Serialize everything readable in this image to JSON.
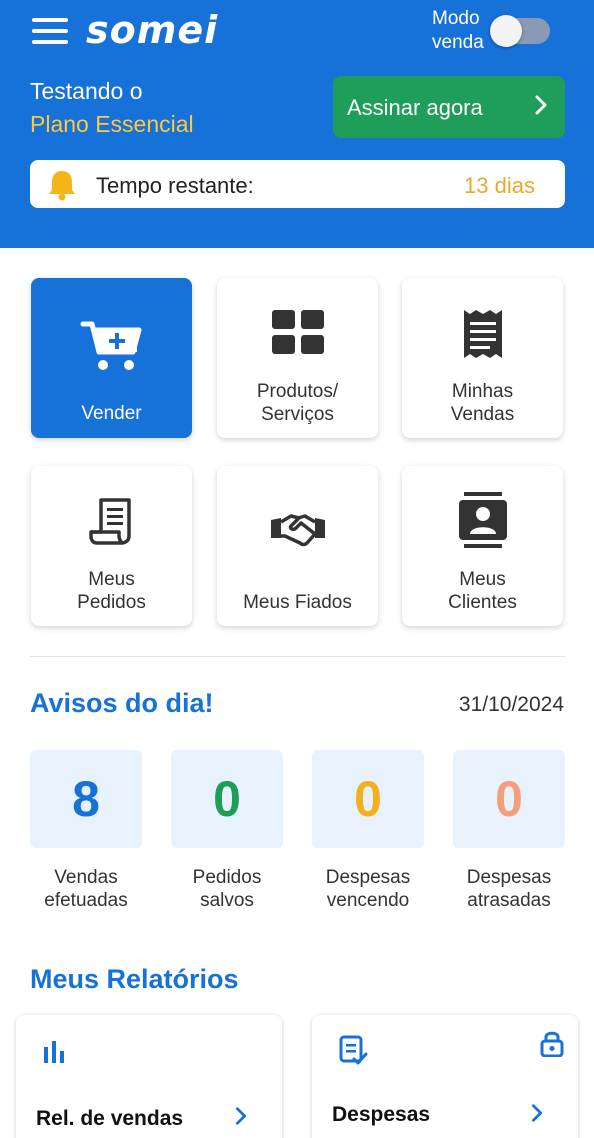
{
  "header": {
    "logo_text": "somei",
    "mode_label_line1": "Modo",
    "mode_label_line2": "venda",
    "mode_toggle_on": false,
    "trial_line1": "Testando o",
    "trial_line2": "Plano Essencial",
    "subscribe_label": "Assinar agora",
    "time_label": "Tempo restante:",
    "time_value": "13 dias",
    "brand_color": "#1671d8"
  },
  "tiles": [
    {
      "label_line1": "Vender",
      "label_line2": "",
      "icon": "cart-add-icon"
    },
    {
      "label_line1": "Produtos/",
      "label_line2": "Serviços",
      "icon": "grid-icon"
    },
    {
      "label_line1": "Minhas",
      "label_line2": "Vendas",
      "icon": "receipt-icon"
    },
    {
      "label_line1": "Meus",
      "label_line2": "Pedidos",
      "icon": "order-doc-icon"
    },
    {
      "label_line1": "Meus Fiados",
      "label_line2": "",
      "icon": "handshake-icon"
    },
    {
      "label_line1": "Meus",
      "label_line2": "Clientes",
      "icon": "contacts-icon"
    }
  ],
  "notices": {
    "title": "Avisos do dia!",
    "date": "31/10/2024",
    "stats": [
      {
        "value": "8",
        "label_line1": "Vendas",
        "label_line2": "efetuadas",
        "color": "#1671d8"
      },
      {
        "value": "0",
        "label_line1": "Pedidos",
        "label_line2": "salvos",
        "color": "#1e9e58"
      },
      {
        "value": "0",
        "label_line1": "Despesas",
        "label_line2": "vencendo",
        "color": "#f2b01e"
      },
      {
        "value": "0",
        "label_line1": "Despesas",
        "label_line2": "atrasadas",
        "color": "#f2a07a"
      }
    ]
  },
  "reports": {
    "title": "Meus Relatórios",
    "cards": [
      {
        "label": "Rel. de vendas",
        "icon": "bar-chart-icon",
        "locked": false
      },
      {
        "label": "Despesas",
        "icon": "expense-doc-icon",
        "locked": true
      }
    ]
  }
}
